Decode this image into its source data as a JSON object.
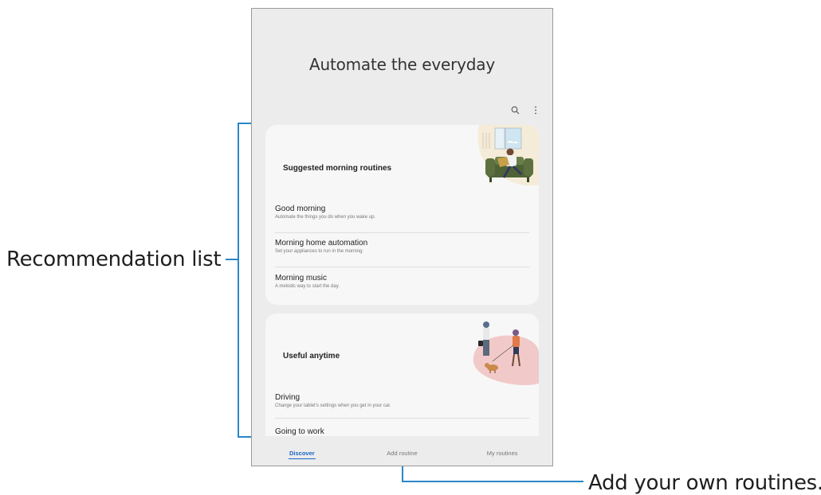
{
  "callouts": {
    "recommendation_list": "Recommendation list",
    "add_routines": "Add your own routines."
  },
  "screen": {
    "title": "Automate the everyday"
  },
  "icons": {
    "search": "search-icon",
    "more": "more-options-icon"
  },
  "cards": [
    {
      "title": "Suggested morning routines",
      "items": [
        {
          "title": "Good morning",
          "desc": "Automate the things you do when you wake up."
        },
        {
          "title": "Morning home automation",
          "desc": "Set your appliances to run in the morning."
        },
        {
          "title": "Morning music",
          "desc": "A melodic way to start the day."
        }
      ]
    },
    {
      "title": "Useful anytime",
      "items": [
        {
          "title": "Driving",
          "desc": "Change your tablet's settings when you get in your car."
        },
        {
          "title": "Going to work",
          "desc": ""
        }
      ]
    }
  ],
  "nav": {
    "discover": "Discover",
    "add_routine": "Add routine",
    "my_routines": "My routines"
  },
  "colors": {
    "accent": "#1a63c7",
    "callout_line": "#2a87c8",
    "screen_bg": "#ececec",
    "card_bg": "#f7f7f7"
  }
}
